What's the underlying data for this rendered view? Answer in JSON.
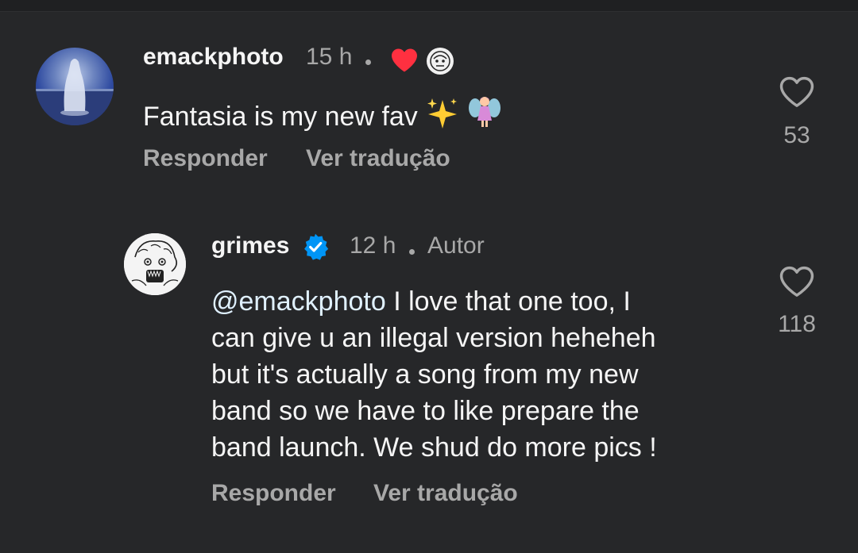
{
  "comments": [
    {
      "username": "emackphoto",
      "time": "15 h",
      "text": "Fantasia is my new fav",
      "reply_label": "Responder",
      "translate_label": "Ver tradução",
      "likes": "53"
    },
    {
      "username": "grimes",
      "time": "12 h",
      "author_label": "Autor",
      "mention": "@emackphoto",
      "text_lines": [
        " I love that one too, I",
        "can give u an illegal version heheheh",
        "but it's actually a song from my new",
        "band so we have to like prepare the",
        "band launch.  We shud do more pics !"
      ],
      "reply_label": "Responder",
      "translate_label": "Ver tradução",
      "likes": "118"
    }
  ],
  "icons": {
    "like": "heart-outline-icon",
    "creator_like": "heart-filled-icon",
    "verified": "verified-badge-icon"
  },
  "colors": {
    "background": "#262729",
    "heart_red": "#ff3040",
    "verified_blue": "#0095f6",
    "muted_text": "#a8a8a8"
  }
}
